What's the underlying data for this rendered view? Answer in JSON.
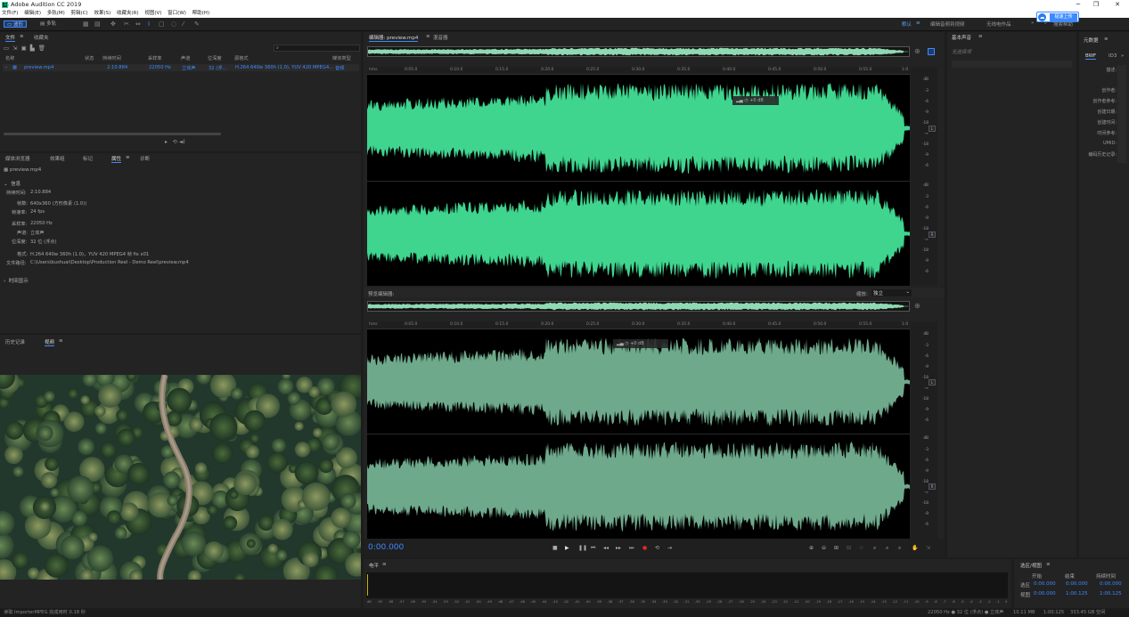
{
  "window": {
    "title": "Adobe Audition CC 2019",
    "logo_text": "Au"
  },
  "menu": [
    "文件(F)",
    "编辑(E)",
    "多轨(M)",
    "剪辑(C)",
    "效果(S)",
    "收藏夹(R)",
    "视图(V)",
    "窗口(W)",
    "帮助(H)"
  ],
  "toolbar": {
    "waveform_label": "波形",
    "multitrack_label": "多轨",
    "workspace_default": "默认",
    "workspace_edit_video": "编辑音频到视频",
    "workspace_radio": "无线电作品",
    "search_placeholder": "搜索帮助",
    "cloud_upload": "极速上传"
  },
  "files_panel": {
    "tabs": [
      "文件",
      "收藏夹"
    ],
    "columns": [
      "名称",
      "状态",
      "持续时间",
      "采样率",
      "声道",
      "位深度",
      "源格式",
      "媒体类型"
    ],
    "row": {
      "name": "preview.mp4",
      "duration": "2:10.884",
      "sample_rate": "22050 Hz",
      "channels": "立体声",
      "bit_depth": "32 (浮...",
      "format": "H.264 640w 360h (1.0), YUV 420 MPEG4...",
      "media_type": "音频"
    }
  },
  "properties_panel": {
    "tabs": [
      "媒体浏览器",
      "效果组",
      "标记",
      "属性",
      "诊断"
    ],
    "file_name": "preview.mp4",
    "section_info": "信息",
    "section_time": "时间显示",
    "fields": [
      {
        "label": "持续时间:",
        "value": "2:10.884"
      },
      {
        "label": "帧数:",
        "value": "640x360 (方形像素 (1.0))"
      },
      {
        "label": "帧速率:",
        "value": "24 fps"
      },
      {
        "label": "采样率:",
        "value": "22050 Hz"
      },
      {
        "label": "声道:",
        "value": "立体声"
      },
      {
        "label": "位深度:",
        "value": "32 位 (浮点)"
      },
      {
        "label": "格式:",
        "value": "H.264 640w 360h (1.0)，YUV 420 MPEG4 帧 fix x01"
      },
      {
        "label": "文件路径:",
        "value": "C:\\Users\\bushuai\\Desktop\\Production Reel - Demo Reel\\preview.mp4"
      }
    ]
  },
  "history_panel": {
    "tabs": [
      "历史记录",
      "视频"
    ]
  },
  "editor": {
    "tabs": [
      "编辑器: preview.mp4",
      "混音器"
    ],
    "time_ticks": [
      "hms",
      "0:05.0",
      "0:10.0",
      "0:15.0",
      "0:20.0",
      "0:25.0",
      "0:30.0",
      "0:35.0",
      "0:40.0",
      "0:45.0",
      "0:50.0",
      "0:55.0",
      "1:0"
    ],
    "db_labels": [
      "dB",
      "-3",
      "-6",
      "-9",
      "-18",
      "-∞",
      "-18",
      "-9",
      "-6",
      "-3"
    ],
    "channel_labels": [
      "L",
      "R"
    ],
    "hud_level": "+0 dB",
    "preview_title": "预览编辑器:",
    "zoom_label": "缩放:",
    "zoom_value": "独立",
    "time_display": "0:00.000"
  },
  "essential_sound": {
    "title": "基本声音",
    "empty": "无选择项"
  },
  "metadata": {
    "title": "元数据",
    "tabs": [
      "BWF",
      "ID3"
    ],
    "labels": [
      "描述:",
      "创作者:",
      "创作者参考:",
      "创建日期:",
      "创建时间:",
      "时间参考:",
      "UMID:",
      "编码历史记录:"
    ]
  },
  "levels": {
    "title": "电平",
    "scale": [
      "dB",
      "-59",
      "-58",
      "-57",
      "-56",
      "-55",
      "-54",
      "-53",
      "-52",
      "-51",
      "-50",
      "-49",
      "-48",
      "-47",
      "-46",
      "-45",
      "-44",
      "-43",
      "-42",
      "-41",
      "-40",
      "-39",
      "-38",
      "-37",
      "-36",
      "-35",
      "-34",
      "-33",
      "-32",
      "-31",
      "-30",
      "-29",
      "-28",
      "-27",
      "-26",
      "-25",
      "-24",
      "-23",
      "-22",
      "-21",
      "-20",
      "-19",
      "-18",
      "-17",
      "-16",
      "-15",
      "-14",
      "-13",
      "-12",
      "-11",
      "-10",
      "-9",
      "-8",
      "-7",
      "-6",
      "-5",
      "-4",
      "-3",
      "-2",
      "-1",
      "0"
    ]
  },
  "selection_panel": {
    "title": "选区/视图",
    "headers": [
      "开始",
      "结束",
      "持续时间"
    ],
    "rows": [
      {
        "label": "选区",
        "start": "0:00.000",
        "end": "0:00.000",
        "duration": "0:00.000"
      },
      {
        "label": "视图",
        "start": "0:00.000",
        "end": "1:00.125",
        "duration": "1:00.125"
      }
    ]
  },
  "status": {
    "left": "读取 ImporterMPEG 完成用时 0.18 秒",
    "format": "22050 Hz ● 32 位 (浮点) ● 立体声",
    "size": "10.11 MB",
    "duration": "1:00.125",
    "free": "333.45 GB 空闲"
  },
  "colors": {
    "accent": "#3d8aff",
    "waveform": "#3fd58f",
    "waveform_preview": "#6ea98b",
    "record": "#e02828"
  }
}
